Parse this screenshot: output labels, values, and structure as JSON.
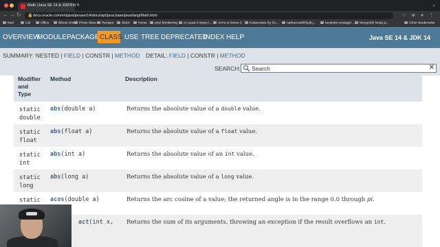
{
  "browser": {
    "traffic_colors": [
      "#ff5f57",
      "#febc2e",
      "#28c840"
    ],
    "tab_title": "Math (Java SE 14 & JDK 14)",
    "new_tab": "+",
    "address": "docs.oracle.com/en/java/javase/14/docs/api/java.base/java/lang/Math.html",
    "bookmarks": [
      "Mail",
      "Cal",
      "Office",
      "Illinois Drive",
      "Photo Sites",
      "Recipes",
      "Slack",
      "Home",
      "pm2 Monitoring",
      "At Least 6 Ways t...",
      "Armo.io Demo 2",
      "Kubernetes By Ex...",
      "nathancahill/Split.j...",
      "bespoke-onstage/...",
      "MongoDB Node.js...",
      "Other Bookmarks"
    ]
  },
  "topnav": {
    "items": [
      "OVERVIEW",
      "MODULE",
      "PACKAGE",
      "CLASS",
      "USE",
      "TREE",
      "DEPRECATED",
      "INDEX",
      "HELP"
    ],
    "active": "CLASS",
    "about": "Java SE 14 & JDK 14",
    "bg_color": "#4d7a97",
    "active_color": "#f8981d"
  },
  "subnav": {
    "summary_label": "SUMMARY:",
    "summary_nested": "NESTED",
    "summary_field": "FIELD",
    "summary_constr": "CONSTR",
    "summary_method": "METHOD",
    "sep": "|",
    "detail_label": "DETAIL:",
    "detail_field": "FIELD",
    "detail_constr": "CONSTR",
    "detail_method": "METHOD",
    "search_label": "SEARCH:",
    "search_placeholder": "Search"
  },
  "table": {
    "header": {
      "modifier": [
        "Modifier",
        "and",
        "Type"
      ],
      "method": "Method",
      "description": "Description"
    },
    "rows": [
      {
        "mod": [
          "static",
          "double"
        ],
        "name": "abs",
        "params": "(double a)",
        "desc_pre": "Returns the absolute value of a ",
        "desc_code": "double",
        "desc_post": " value."
      },
      {
        "mod": [
          "static",
          "float"
        ],
        "name": "abs",
        "params": "(float a)",
        "desc_pre": "Returns the absolute value of a ",
        "desc_code": "float",
        "desc_post": " value."
      },
      {
        "mod": [
          "static",
          "int"
        ],
        "name": "abs",
        "params": "(int a)",
        "desc_pre": "Returns the absolute value of an ",
        "desc_code": "int",
        "desc_post": " value."
      },
      {
        "mod": [
          "static",
          "long"
        ],
        "name": "abs",
        "params": "(long a)",
        "desc_pre": "Returns the absolute value of a ",
        "desc_code": "long",
        "desc_post": " value."
      },
      {
        "mod": [
          "static",
          ""
        ],
        "name": "acos",
        "params": "(double a)",
        "desc_pre": "Returns the arc cosine of a value; the returned angle is in the range 0.0 through ",
        "desc_em": "pi",
        "desc_post": "."
      },
      {
        "mod": [
          "",
          ""
        ],
        "name": "act",
        "params": "(int x,",
        "desc_pre": "Returns the sum of its arguments, throwing an exception if the result overflows an ",
        "desc_code": "int",
        "desc_post": "."
      }
    ]
  }
}
